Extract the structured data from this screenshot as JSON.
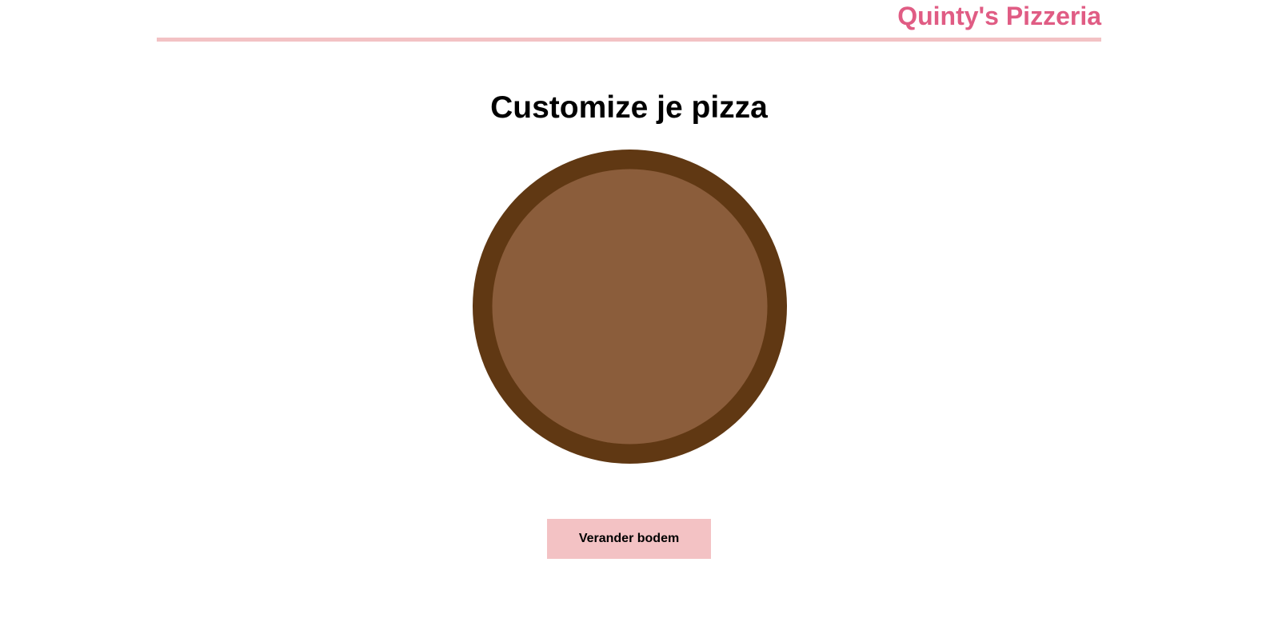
{
  "header": {
    "brand": "Quinty's Pizzeria"
  },
  "main": {
    "title": "Customize je pizza",
    "pizza": {
      "crust_color": "#603813",
      "base_color": "#8b5d3b"
    },
    "change_base_button": "Verander bodem"
  },
  "colors": {
    "brand_accent": "#e05c84",
    "header_rule": "#f3c2c4",
    "button_background": "#f3c2c4"
  }
}
